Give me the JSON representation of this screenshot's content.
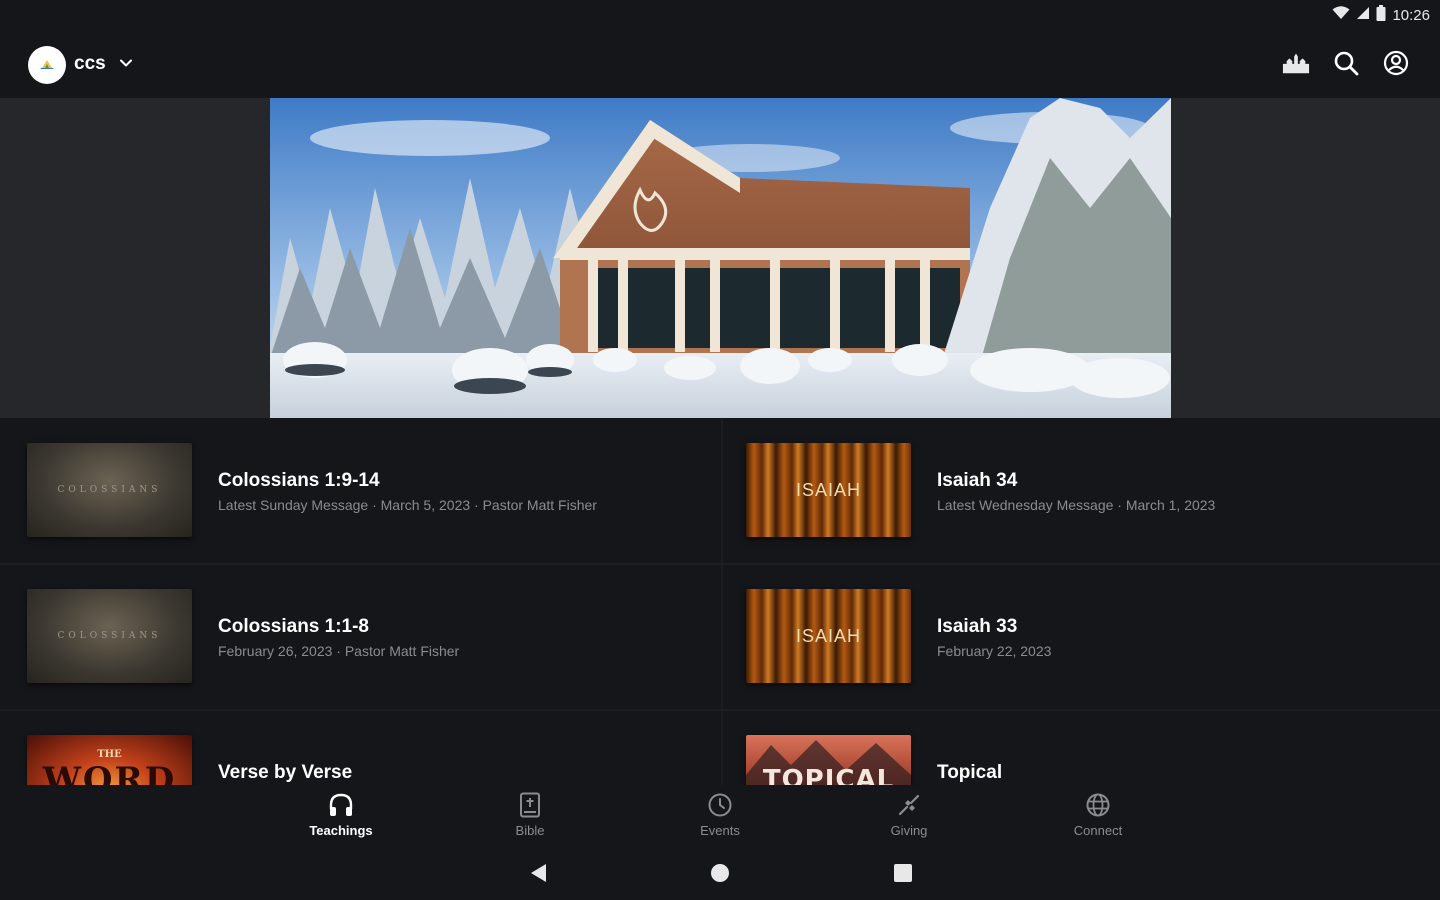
{
  "status_bar": {
    "time": "10:26"
  },
  "header": {
    "org_name": "ccs",
    "actions": [
      "church-icon",
      "search-icon",
      "account-icon"
    ]
  },
  "teachings": [
    {
      "title": "Colossians 1:9-14",
      "subtitle": "Latest Sunday Message · March 5, 2023 · Pastor Matt Fisher",
      "thumb_text": "COLOSSIANS"
    },
    {
      "title": "Isaiah 34",
      "subtitle": "Latest Wednesday Message · March 1, 2023",
      "thumb_text": "ISAIAH"
    },
    {
      "title": "Colossians 1:1-8",
      "subtitle": "February 26, 2023 · Pastor Matt Fisher",
      "thumb_text": "COLOSSIANS"
    },
    {
      "title": "Isaiah 33",
      "subtitle": "February 22, 2023",
      "thumb_text": "ISAIAH"
    },
    {
      "title": "Verse by Verse",
      "subtitle": "",
      "thumb_small": "THE",
      "thumb_big": "WORD"
    },
    {
      "title": "Topical",
      "subtitle": "",
      "thumb_text": "TOPICAL"
    }
  ],
  "bottom_nav": [
    {
      "label": "Teachings",
      "icon": "headphones-icon",
      "active": true
    },
    {
      "label": "Bible",
      "icon": "bible-icon",
      "active": false
    },
    {
      "label": "Events",
      "icon": "clock-icon",
      "active": false
    },
    {
      "label": "Giving",
      "icon": "giving-icon",
      "active": false
    },
    {
      "label": "Connect",
      "icon": "globe-icon",
      "active": false
    }
  ],
  "colors": {
    "background": "#151619",
    "hero_band": "#26272b",
    "text_primary": "#ffffff",
    "text_secondary": "#8a8c92"
  }
}
